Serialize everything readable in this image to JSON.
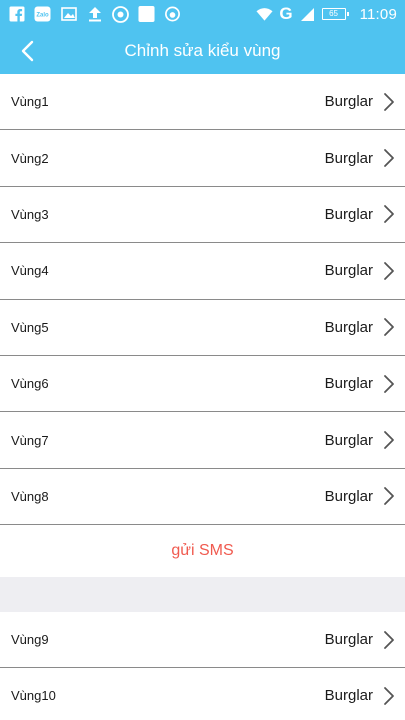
{
  "status_bar": {
    "time": "11:09",
    "network": "G",
    "battery": "65",
    "icons": [
      "facebook-icon",
      "zalo-icon",
      "image-icon",
      "upload-icon",
      "chrome-icon",
      "blank-app-icon",
      "eye-icon",
      "wifi-icon",
      "signal-icon",
      "battery-icon"
    ],
    "zalo_label": "Zalo"
  },
  "header": {
    "title": "Chỉnh sửa kiểu vùng",
    "background": "#4fc3f0"
  },
  "zones_group1": [
    {
      "label": "Vùng1",
      "value": "Burglar"
    },
    {
      "label": "Vùng2",
      "value": "Burglar"
    },
    {
      "label": "Vùng3",
      "value": "Burglar"
    },
    {
      "label": "Vùng4",
      "value": "Burglar"
    },
    {
      "label": "Vùng5",
      "value": "Burglar"
    },
    {
      "label": "Vùng6",
      "value": "Burglar"
    },
    {
      "label": "Vùng7",
      "value": "Burglar"
    },
    {
      "label": "Vùng8",
      "value": "Burglar"
    }
  ],
  "send_sms": {
    "label": "gửi SMS",
    "color": "#f05a4f"
  },
  "zones_group2": [
    {
      "label": "Vùng9",
      "value": "Burglar"
    },
    {
      "label": "Vùng10",
      "value": "Burglar"
    }
  ]
}
